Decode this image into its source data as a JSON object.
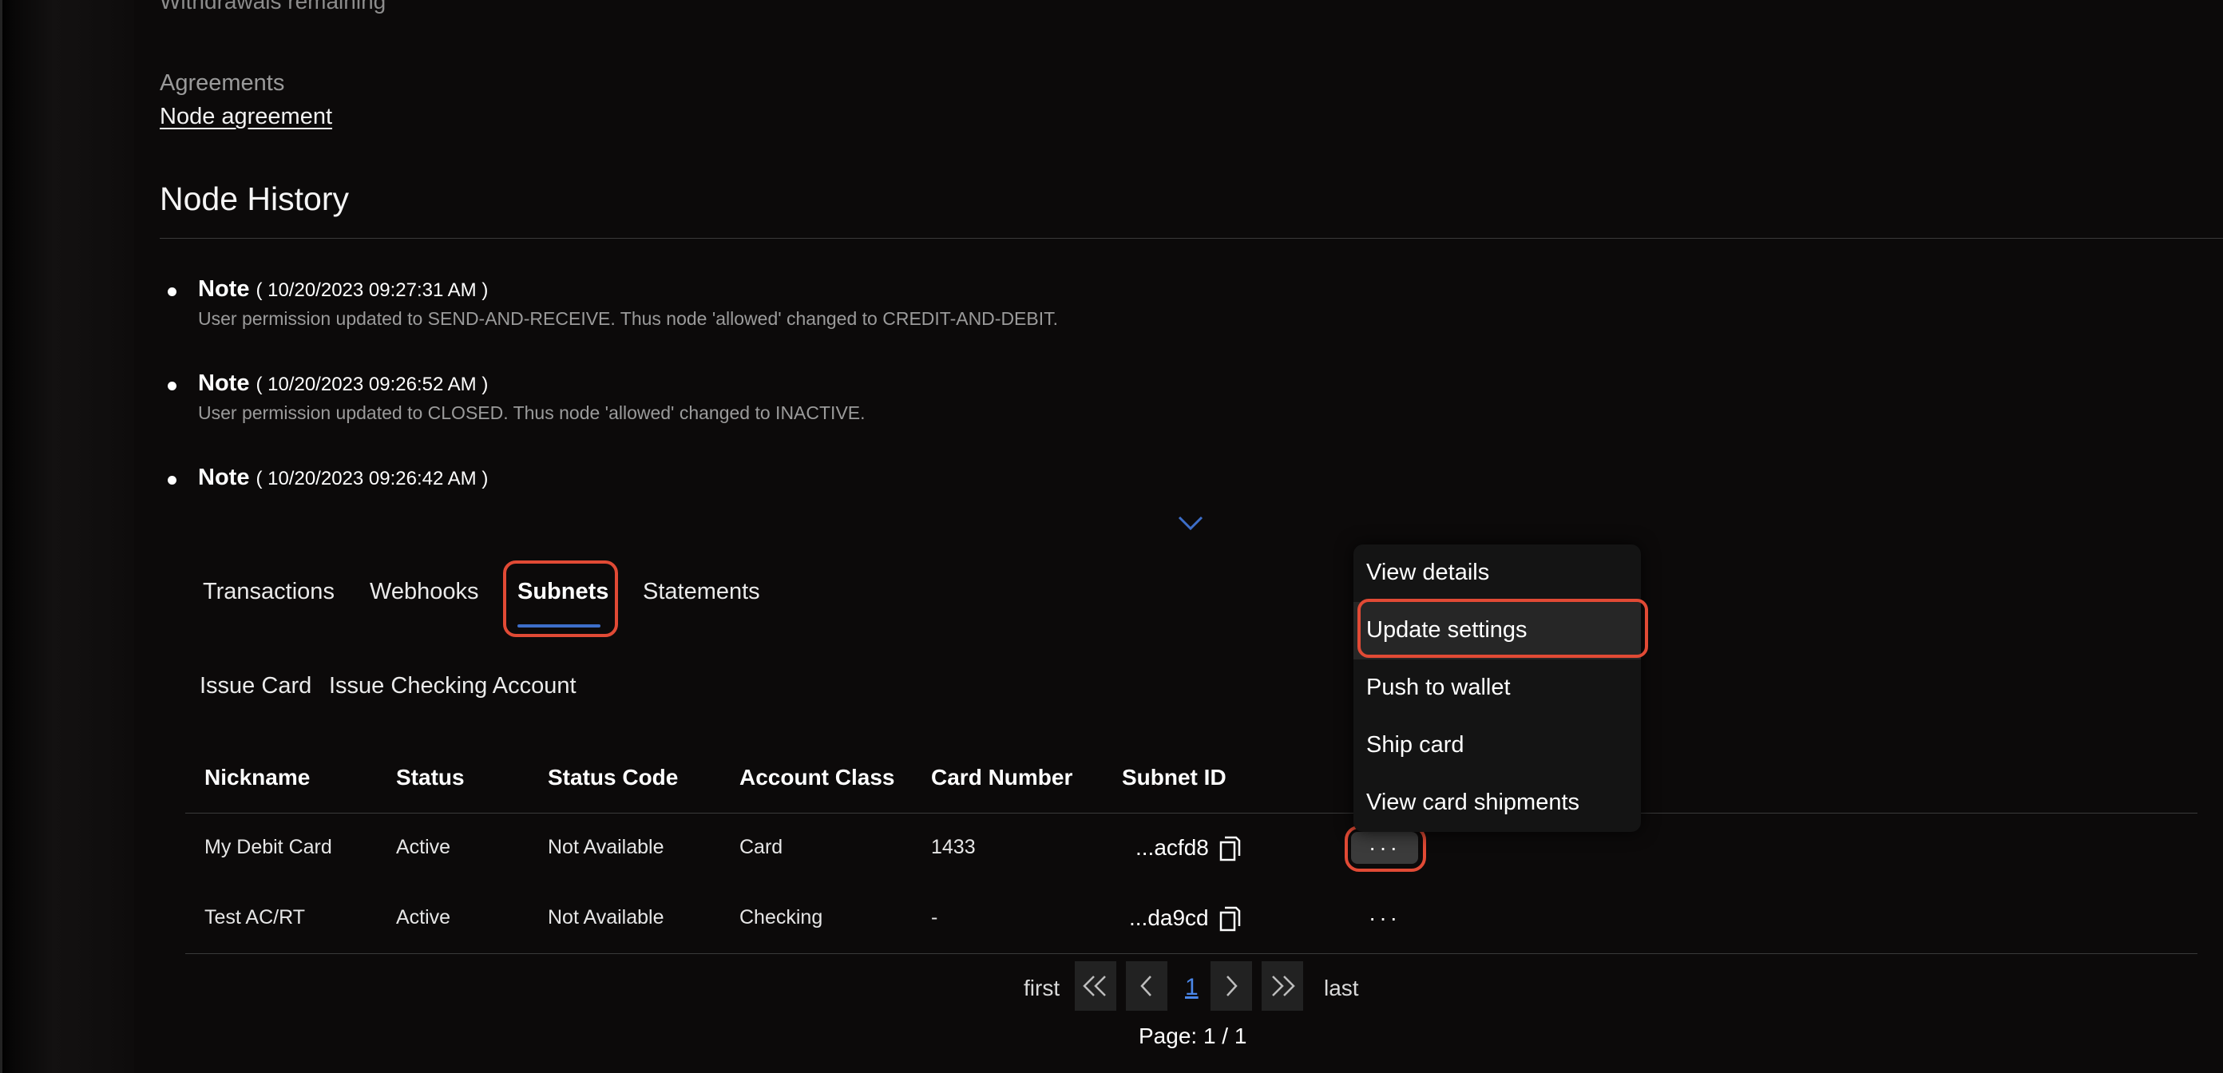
{
  "top_partial_text": "Withdrawals remaining",
  "agreements": {
    "label": "Agreements",
    "link": "Node agreement"
  },
  "history": {
    "title": "Node History",
    "notes": [
      {
        "keyword": "Note",
        "timestamp": "( 10/20/2023 09:27:31 AM )",
        "text": "User permission updated to SEND-AND-RECEIVE. Thus node 'allowed' changed to CREDIT-AND-DEBIT."
      },
      {
        "keyword": "Note",
        "timestamp": "( 10/20/2023 09:26:52 AM )",
        "text": "User permission updated to CLOSED. Thus node 'allowed' changed to INACTIVE."
      },
      {
        "keyword": "Note",
        "timestamp": "( 10/20/2023 09:26:42 AM )",
        "text": ""
      }
    ]
  },
  "tabs": [
    {
      "label": "Transactions"
    },
    {
      "label": "Webhooks"
    },
    {
      "label": "Subnets"
    },
    {
      "label": "Statements"
    }
  ],
  "actions": {
    "issue_card": "Issue Card",
    "issue_checking": "Issue Checking Account"
  },
  "table": {
    "columns": [
      "Nickname",
      "Status",
      "Status Code",
      "Account Class",
      "Card Number",
      "Subnet ID"
    ],
    "rows": [
      {
        "nickname": "My Debit Card",
        "status": "Active",
        "status_code": "Not Available",
        "account_class": "Card",
        "card_number": "1433",
        "subnet_id": "...acfd8",
        "more": "···"
      },
      {
        "nickname": "Test AC/RT",
        "status": "Active",
        "status_code": "Not Available",
        "account_class": "Checking",
        "card_number": "-",
        "subnet_id": "...da9cd",
        "more": "···"
      }
    ]
  },
  "row_menu": {
    "items": [
      "View details",
      "Update settings",
      "Push to wallet",
      "Ship card",
      "View card shipments"
    ]
  },
  "pagination": {
    "first": "first",
    "last": "last",
    "current_page": "1",
    "status": "Page: 1 / 1"
  },
  "colors": {
    "background": "#0c0a0a",
    "highlight": "#e14a35",
    "active_tab_underline": "#3d6ec9",
    "page_link": "#4a86e8"
  },
  "icons": [
    "chevron-down-icon",
    "copy-icon",
    "more-horizontal-icon",
    "double-chevron-left-icon",
    "chevron-left-icon",
    "chevron-right-icon",
    "double-chevron-right-icon"
  ]
}
